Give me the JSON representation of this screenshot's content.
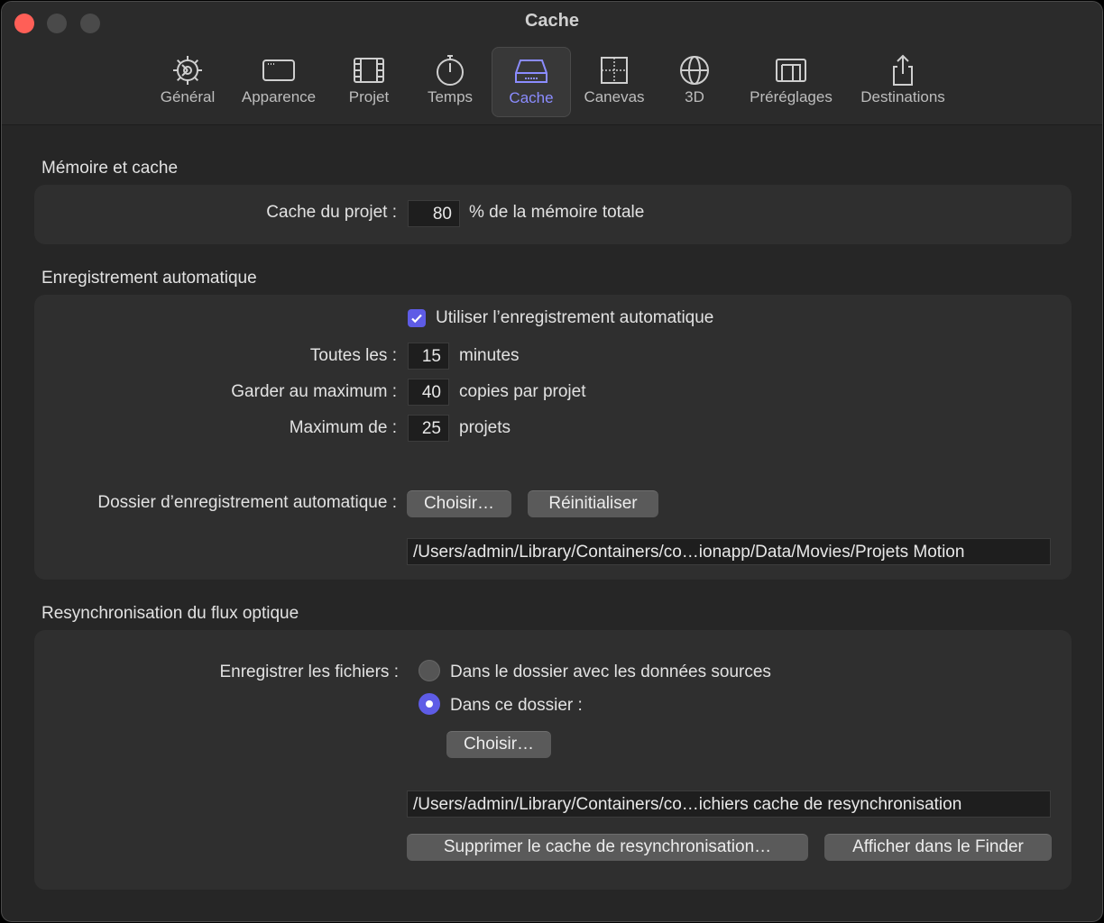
{
  "window": {
    "title": "Cache"
  },
  "toolbar": {
    "items": [
      {
        "label": "Général",
        "icon": "gear-icon"
      },
      {
        "label": "Apparence",
        "icon": "window-icon"
      },
      {
        "label": "Projet",
        "icon": "film-strip-icon"
      },
      {
        "label": "Temps",
        "icon": "stopwatch-icon"
      },
      {
        "label": "Cache",
        "icon": "drive-icon",
        "selected": true
      },
      {
        "label": "Canevas",
        "icon": "canvas-grid-icon"
      },
      {
        "label": "3D",
        "icon": "globe-icon"
      },
      {
        "label": "Préréglages",
        "icon": "presets-icon"
      },
      {
        "label": "Destinations",
        "icon": "share-icon"
      }
    ]
  },
  "memory": {
    "section_title": "Mémoire et cache",
    "project_cache_label": "Cache du projet :",
    "project_cache_value": "80",
    "project_cache_unit": "% de la mémoire totale"
  },
  "autosave": {
    "section_title": "Enregistrement automatique",
    "use_autosave_label": "Utiliser l’enregistrement automatique",
    "use_autosave_checked": true,
    "every_label": "Toutes les :",
    "every_value": "15",
    "every_unit": "minutes",
    "keep_label": "Garder au maximum :",
    "keep_value": "40",
    "keep_unit": "copies par projet",
    "max_label": "Maximum de :",
    "max_value": "25",
    "max_unit": "projets",
    "folder_label": "Dossier d’enregistrement automatique :",
    "choose_button": "Choisir…",
    "reset_button": "Réinitialiser",
    "folder_path": "/Users/admin/Library/Containers/co…ionapp/Data/Movies/Projets Motion"
  },
  "resync": {
    "section_title": "Resynchronisation du flux optique",
    "save_files_label": "Enregistrer les fichiers :",
    "option_source": "Dans le dossier avec les données sources",
    "option_folder": "Dans ce dossier :",
    "selected_option": "option_folder",
    "choose_button": "Choisir…",
    "folder_path": "/Users/admin/Library/Containers/co…ichiers cache de resynchronisation",
    "delete_cache_button": "Supprimer le cache de resynchronisation…",
    "show_in_finder_button": "Afficher dans le Finder"
  },
  "colors": {
    "accent": "#5e5ce6",
    "selected_label": "#8b8cff",
    "close_button": "#ff5f57"
  }
}
